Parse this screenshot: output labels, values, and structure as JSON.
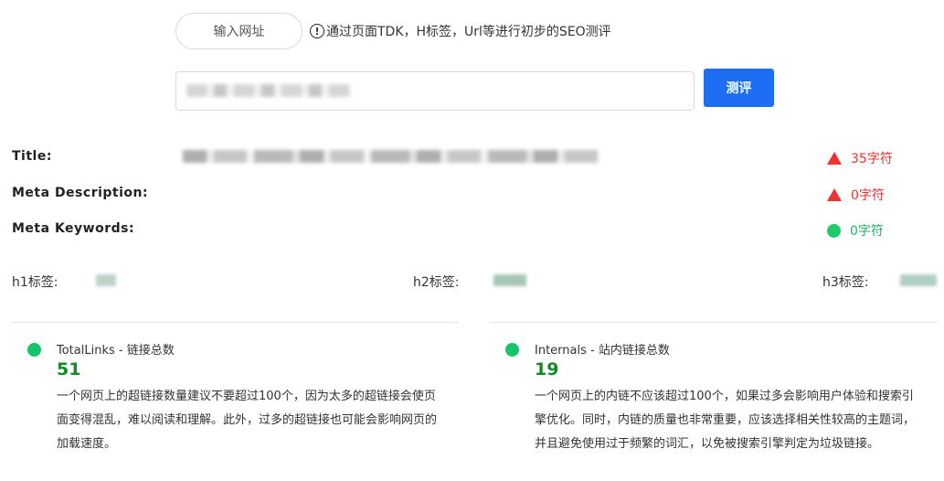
{
  "top": {
    "url_button": "输入网址",
    "hint": "通过页面TDK，H标签，Url等进行初步的SEO测评",
    "hint_icon": "exclamation-circle-icon",
    "url_placeholder": "",
    "test_button": "测评"
  },
  "meta": {
    "title_label": "Title:",
    "title_status": "35字符",
    "description_label": "Meta Description:",
    "description_status": "0字符",
    "keywords_label": "Meta Keywords:",
    "keywords_status": "0字符"
  },
  "headings": {
    "h1_label": "h1标签:",
    "h2_label": "h2标签:",
    "h3_label": "h3标签:"
  },
  "cards": [
    {
      "title": "TotalLinks - 链接总数",
      "value": "51",
      "description": "一个网页上的超链接数量建议不要超过100个，因为太多的超链接会使页面变得混乱，难以阅读和理解。此外，过多的超链接也可能会影响网页的加载速度。"
    },
    {
      "title": "Internals - 站内链接总数",
      "value": "19",
      "description": "一个网页上的内链不应该超过100个，如果过多会影响用户体验和搜索引擎优化。同时，内链的质量也非常重要，应该选择相关性较高的主题词，并且避免使用过于频繁的词汇，以免被搜索引擎判定为垃圾链接。"
    }
  ],
  "colors": {
    "accent": "#1e6ef4",
    "warning": "#e33333",
    "ok": "#1fca6b",
    "value_green": "#138a24"
  }
}
